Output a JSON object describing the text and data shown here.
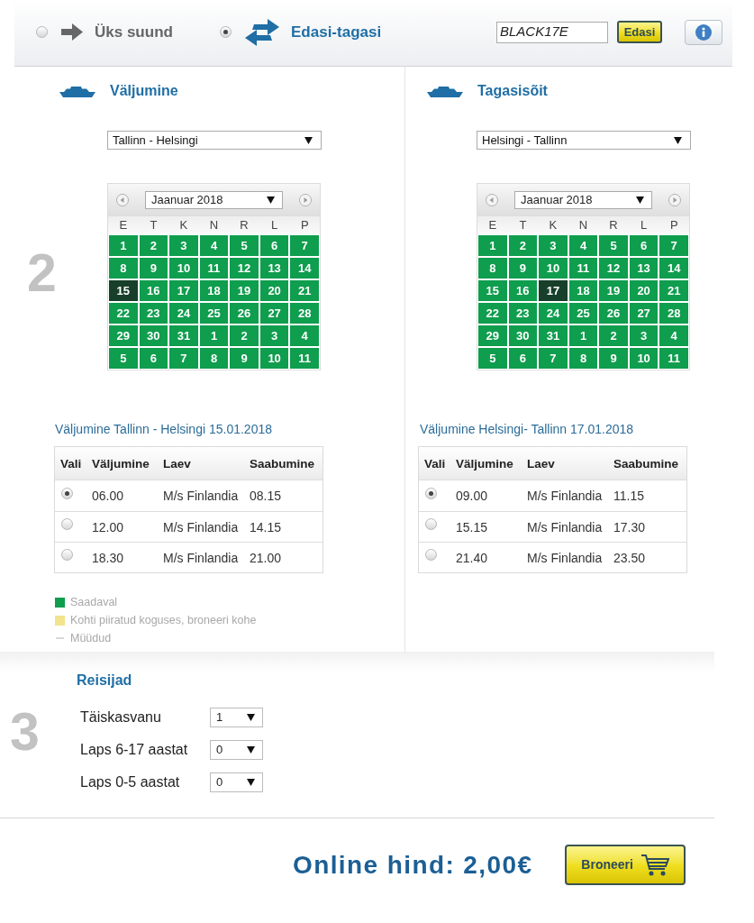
{
  "trip_type": [
    {
      "kind": "one_way",
      "label": "Üks suund",
      "selected": false
    },
    {
      "kind": "return",
      "label": "Edasi-tagasi",
      "selected": true
    }
  ],
  "promo": {
    "value": "BLACK17E",
    "button": "Edasi"
  },
  "schedule": {
    "step": "2",
    "legs": [
      {
        "title": "Väljumine",
        "route": "Tallinn - Helsingi",
        "calendar": {
          "month": "Jaanuar 2018",
          "weekdays": [
            "E",
            "T",
            "K",
            "N",
            "R",
            "L",
            "P"
          ],
          "days": [
            {
              "label": "1",
              "selected": false
            },
            {
              "label": "2",
              "selected": false
            },
            {
              "label": "3",
              "selected": false
            },
            {
              "label": "4",
              "selected": false
            },
            {
              "label": "5",
              "selected": false
            },
            {
              "label": "6",
              "selected": false
            },
            {
              "label": "7",
              "selected": false
            },
            {
              "label": "8",
              "selected": false
            },
            {
              "label": "9",
              "selected": false
            },
            {
              "label": "10",
              "selected": false
            },
            {
              "label": "11",
              "selected": false
            },
            {
              "label": "12",
              "selected": false
            },
            {
              "label": "13",
              "selected": false
            },
            {
              "label": "14",
              "selected": false
            },
            {
              "label": "15",
              "selected": true
            },
            {
              "label": "16",
              "selected": false
            },
            {
              "label": "17",
              "selected": false
            },
            {
              "label": "18",
              "selected": false
            },
            {
              "label": "19",
              "selected": false
            },
            {
              "label": "20",
              "selected": false
            },
            {
              "label": "21",
              "selected": false
            },
            {
              "label": "22",
              "selected": false
            },
            {
              "label": "23",
              "selected": false
            },
            {
              "label": "24",
              "selected": false
            },
            {
              "label": "25",
              "selected": false
            },
            {
              "label": "26",
              "selected": false
            },
            {
              "label": "27",
              "selected": false
            },
            {
              "label": "28",
              "selected": false
            },
            {
              "label": "29",
              "selected": false
            },
            {
              "label": "30",
              "selected": false
            },
            {
              "label": "31",
              "selected": false
            },
            {
              "label": "1",
              "selected": false
            },
            {
              "label": "2",
              "selected": false
            },
            {
              "label": "3",
              "selected": false
            },
            {
              "label": "4",
              "selected": false
            },
            {
              "label": "5",
              "selected": false
            },
            {
              "label": "6",
              "selected": false
            },
            {
              "label": "7",
              "selected": false
            },
            {
              "label": "8",
              "selected": false
            },
            {
              "label": "9",
              "selected": false
            },
            {
              "label": "10",
              "selected": false
            },
            {
              "label": "11",
              "selected": false
            }
          ]
        },
        "caption": "Väljumine Tallinn - Helsingi 15.01.2018",
        "table": {
          "columns": [
            "Vali",
            "Väljumine",
            "Laev",
            "Saabumine"
          ],
          "rows": [
            {
              "selected": true,
              "departure": "06.00",
              "ship": "M/s Finlandia",
              "arrival": "08.15"
            },
            {
              "selected": false,
              "departure": "12.00",
              "ship": "M/s Finlandia",
              "arrival": "14.15"
            },
            {
              "selected": false,
              "departure": "18.30",
              "ship": "M/s Finlandia",
              "arrival": "21.00"
            }
          ]
        }
      },
      {
        "title": "Tagasisõit",
        "route": "Helsingi - Tallinn",
        "calendar": {
          "month": "Jaanuar 2018",
          "weekdays": [
            "E",
            "T",
            "K",
            "N",
            "R",
            "L",
            "P"
          ],
          "days": [
            {
              "label": "1",
              "selected": false
            },
            {
              "label": "2",
              "selected": false
            },
            {
              "label": "3",
              "selected": false
            },
            {
              "label": "4",
              "selected": false
            },
            {
              "label": "5",
              "selected": false
            },
            {
              "label": "6",
              "selected": false
            },
            {
              "label": "7",
              "selected": false
            },
            {
              "label": "8",
              "selected": false
            },
            {
              "label": "9",
              "selected": false
            },
            {
              "label": "10",
              "selected": false
            },
            {
              "label": "11",
              "selected": false
            },
            {
              "label": "12",
              "selected": false
            },
            {
              "label": "13",
              "selected": false
            },
            {
              "label": "14",
              "selected": false
            },
            {
              "label": "15",
              "selected": false
            },
            {
              "label": "16",
              "selected": false
            },
            {
              "label": "17",
              "selected": true
            },
            {
              "label": "18",
              "selected": false
            },
            {
              "label": "19",
              "selected": false
            },
            {
              "label": "20",
              "selected": false
            },
            {
              "label": "21",
              "selected": false
            },
            {
              "label": "22",
              "selected": false
            },
            {
              "label": "23",
              "selected": false
            },
            {
              "label": "24",
              "selected": false
            },
            {
              "label": "25",
              "selected": false
            },
            {
              "label": "26",
              "selected": false
            },
            {
              "label": "27",
              "selected": false
            },
            {
              "label": "28",
              "selected": false
            },
            {
              "label": "29",
              "selected": false
            },
            {
              "label": "30",
              "selected": false
            },
            {
              "label": "31",
              "selected": false
            },
            {
              "label": "1",
              "selected": false
            },
            {
              "label": "2",
              "selected": false
            },
            {
              "label": "3",
              "selected": false
            },
            {
              "label": "4",
              "selected": false
            },
            {
              "label": "5",
              "selected": false
            },
            {
              "label": "6",
              "selected": false
            },
            {
              "label": "7",
              "selected": false
            },
            {
              "label": "8",
              "selected": false
            },
            {
              "label": "9",
              "selected": false
            },
            {
              "label": "10",
              "selected": false
            },
            {
              "label": "11",
              "selected": false
            }
          ]
        },
        "caption": "Väljumine Helsingi- Tallinn 17.01.2018",
        "table": {
          "columns": [
            "Vali",
            "Väljumine",
            "Laev",
            "Saabumine"
          ],
          "rows": [
            {
              "selected": true,
              "departure": "09.00",
              "ship": "M/s Finlandia",
              "arrival": "11.15"
            },
            {
              "selected": false,
              "departure": "15.15",
              "ship": "M/s Finlandia",
              "arrival": "17.30"
            },
            {
              "selected": false,
              "departure": "21.40",
              "ship": "M/s Finlandia",
              "arrival": "23.50"
            }
          ]
        }
      }
    ],
    "legend": [
      {
        "kind": "swatch",
        "color": "#0f9d4e",
        "label": "Saadaval"
      },
      {
        "kind": "swatch",
        "color": "#f2e38c",
        "label": "Kohti piiratud koguses, broneeri kohe"
      },
      {
        "kind": "dash",
        "color": "#d9d9d9",
        "label": "Müüdud"
      }
    ]
  },
  "passengers": {
    "step": "3",
    "title": "Reisijad",
    "rows": [
      {
        "label": "Täiskasvanu",
        "value": "1"
      },
      {
        "label": "Laps 6-17 aastat",
        "value": "0"
      },
      {
        "label": "Laps 0-5 aastat",
        "value": "0"
      }
    ]
  },
  "footer": {
    "price": "Online hind: 2,00€",
    "button": "Broneeri"
  }
}
